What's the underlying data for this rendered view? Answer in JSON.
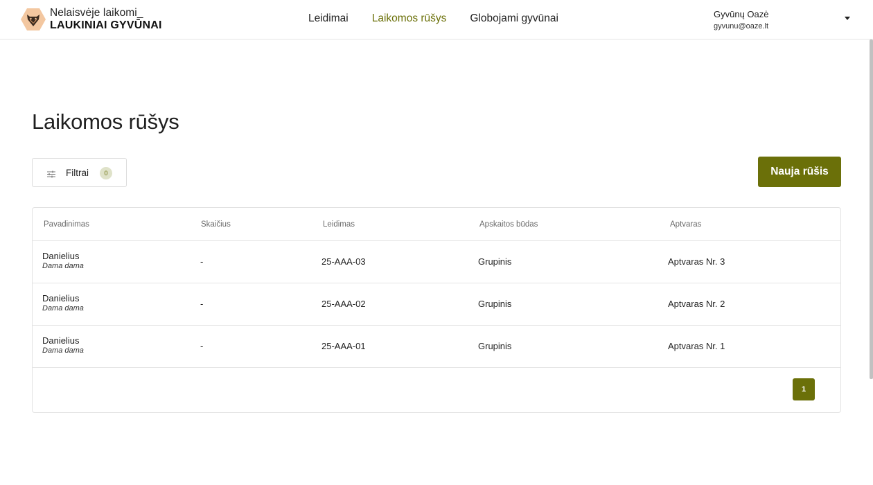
{
  "header": {
    "logo_line1": "Nelaisvėje laikomi_",
    "logo_line2": "LAUKINIAI GYVŪNAI",
    "nav": [
      {
        "label": "Leidimai",
        "active": false
      },
      {
        "label": "Laikomos rūšys",
        "active": true
      },
      {
        "label": "Globojami gyvūnai",
        "active": false
      }
    ],
    "user_name": "Gyvūnų Oazė",
    "user_email": "gyvunu@oaze.lt"
  },
  "main": {
    "title": "Laikomos rūšys",
    "filter_label": "Filtrai",
    "filter_count": "0",
    "new_button": "Nauja rūšis"
  },
  "table": {
    "columns": [
      "Pavadinimas",
      "Skaičius",
      "Leidimas",
      "Apskaitos būdas",
      "Aptvaras"
    ],
    "rows": [
      {
        "name": "Danielius",
        "latin": "Dama dama",
        "count": "-",
        "permit": "25-AAA-03",
        "method": "Grupinis",
        "enclosure": "Aptvaras Nr. 3"
      },
      {
        "name": "Danielius",
        "latin": "Dama dama",
        "count": "-",
        "permit": "25-AAA-02",
        "method": "Grupinis",
        "enclosure": "Aptvaras Nr. 2"
      },
      {
        "name": "Danielius",
        "latin": "Dama dama",
        "count": "-",
        "permit": "25-AAA-01",
        "method": "Grupinis",
        "enclosure": "Aptvaras Nr. 1"
      }
    ],
    "page": "1"
  },
  "colors": {
    "accent": "#6b7009",
    "logo_badge": "#f3c7a0"
  },
  "icons": {
    "logo": "fox-head-icon",
    "filter": "sliders-icon",
    "user_menu": "caret-down-icon"
  }
}
